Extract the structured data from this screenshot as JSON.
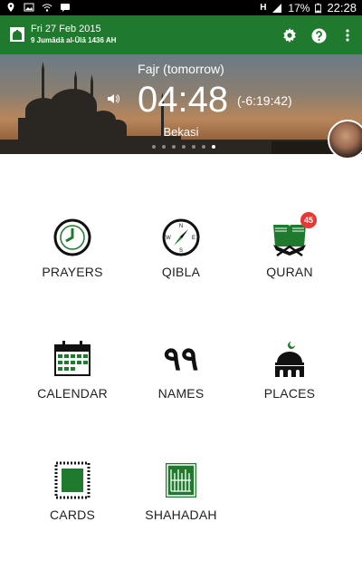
{
  "status_bar": {
    "battery": "17%",
    "time": "22:28"
  },
  "app_bar": {
    "date": "Fri 27 Feb 2015",
    "hijri": "9 Jumādā al-Ūlā 1436 AH"
  },
  "hero": {
    "prayer_name": "Fajr (tomorrow)",
    "time": "04:48",
    "remaining": "(-6:19:42)",
    "city": "Bekasi",
    "page_indicator": {
      "count": 7,
      "active": 7
    }
  },
  "menu": {
    "prayers": "PRAYERS",
    "qibla": "QIBLA",
    "quran": "QURAN",
    "quran_badge": "45",
    "calendar": "CALENDAR",
    "names": "NAMES",
    "names_glyph": "٩٩",
    "places": "PLACES",
    "cards": "CARDS",
    "shahadah": "SHAHADAH"
  },
  "colors": {
    "primary": "#1f7a2e",
    "accent": "#e53935"
  }
}
